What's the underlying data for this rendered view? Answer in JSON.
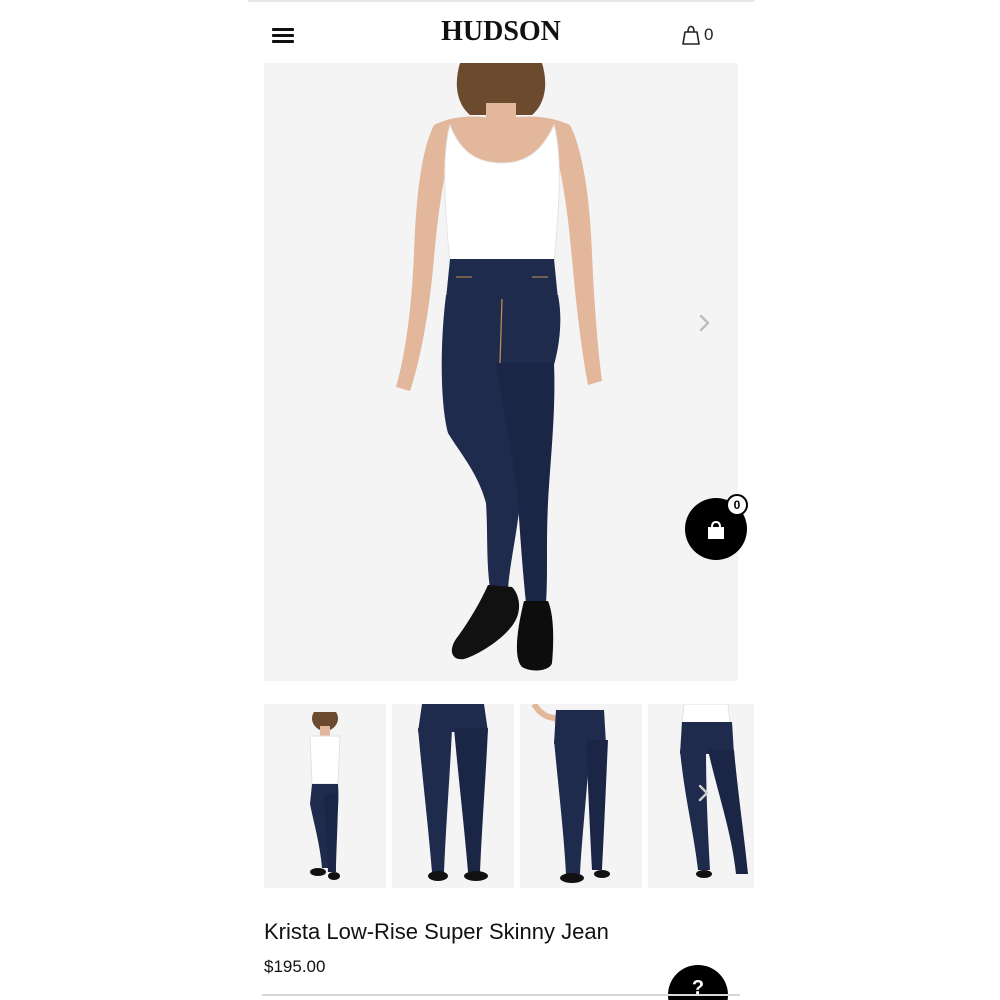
{
  "header": {
    "brand": "HUDSON",
    "cart_count": "0",
    "menu_icon": "hamburger-menu-icon",
    "cart_icon": "shopping-bag-icon"
  },
  "gallery": {
    "next_icon": "chevron-right-icon",
    "thumbnail_count": 4
  },
  "floating_cart": {
    "count": "0",
    "icon": "shopping-bag-icon"
  },
  "product": {
    "title": "Krista Low-Rise Super Skinny Jean",
    "price": "$195.00"
  },
  "help": {
    "label": "?",
    "icon": "help-icon"
  },
  "colors": {
    "denim": "#1f2b4d",
    "background": "#f4f4f4",
    "accent": "#000000"
  }
}
